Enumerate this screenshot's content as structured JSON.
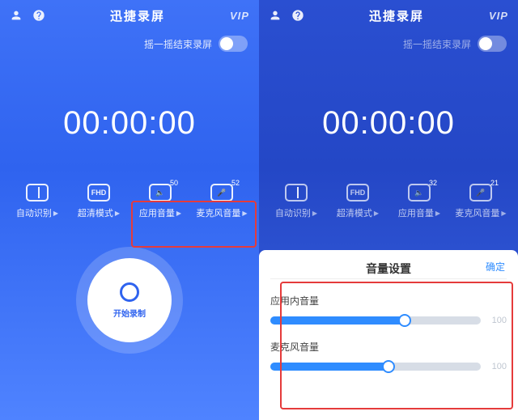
{
  "header": {
    "title": "迅捷录屏",
    "vip": "VIP"
  },
  "shake": {
    "label": "摇一摇结束录屏"
  },
  "timer": "00:00:00",
  "options": {
    "orientation": {
      "label": "自动识别"
    },
    "quality": {
      "label": "超清模式",
      "icon_text": "FHD"
    },
    "app_volume": {
      "label": "应用音量",
      "badge_left": "50",
      "badge_right": "32"
    },
    "mic_volume": {
      "label": "麦克风音量",
      "badge_left": "52",
      "badge_right": "21"
    }
  },
  "record": {
    "label": "开始录制"
  },
  "sheet": {
    "title": "音量设置",
    "confirm": "确定",
    "sliders": [
      {
        "label": "应用内音量",
        "value": 64,
        "max": 100
      },
      {
        "label": "麦克风音量",
        "value": 56,
        "max": 100
      }
    ]
  }
}
